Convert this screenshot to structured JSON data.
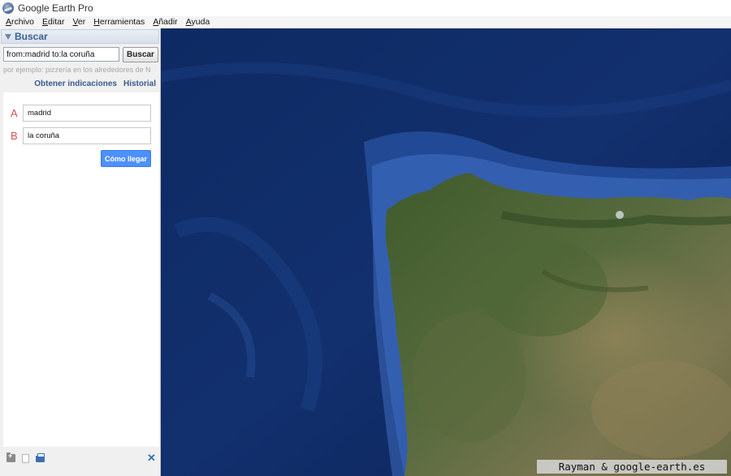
{
  "window": {
    "title": "Google Earth Pro",
    "icon": "google-earth-icon"
  },
  "menu": [
    {
      "mnemonic": "A",
      "rest": "rchivo"
    },
    {
      "mnemonic": "E",
      "rest": "ditar"
    },
    {
      "mnemonic": "V",
      "rest": "er"
    },
    {
      "mnemonic": "H",
      "rest": "erramientas"
    },
    {
      "mnemonic": "A",
      "rest": "ñadir"
    },
    {
      "mnemonic": "A",
      "rest": "yuda"
    }
  ],
  "search": {
    "header": "Buscar",
    "query": "from:madrid to:la coruña",
    "button": "Buscar",
    "hint": "por ejemplo: pizzería en los alrededores de N",
    "links": {
      "directions": "Obtener indicaciones",
      "history": "Historial"
    }
  },
  "directions": {
    "from_letter": "A",
    "from_value": "madrid",
    "to_letter": "B",
    "to_value": "la coruña",
    "button": "Cómo llegar"
  },
  "map": {
    "watermark": "Rayman & google-earth.es"
  },
  "colors": {
    "accent_blue": "#4d90fe",
    "header_text": "#3d5f92",
    "ocean": "#0d2557",
    "marker_letter": "#d35050"
  }
}
